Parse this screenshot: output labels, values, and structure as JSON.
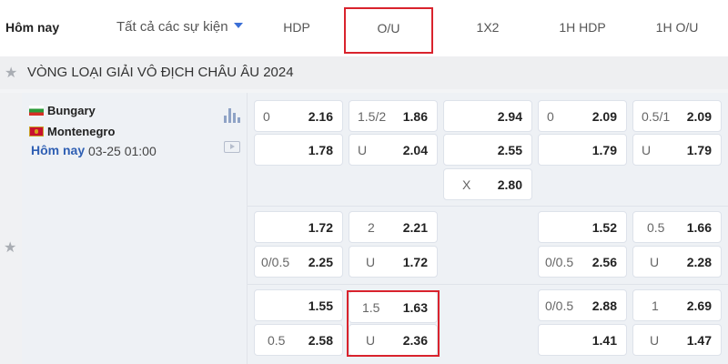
{
  "tabs": {
    "today": "Hôm nay",
    "all_events": "Tất cả các sự kiện",
    "markets": [
      "HDP",
      "O/U",
      "1X2",
      "1H HDP",
      "1H O/U"
    ],
    "selected_market": "O/U"
  },
  "league": {
    "name": "VÒNG LOẠI GIẢI VÔ ĐỊCH CHÂU ÂU 2024"
  },
  "match": {
    "home": "Bungary",
    "away": "Montenegro",
    "day": "Hôm nay",
    "kickoff": "03-25 01:00"
  },
  "odds": {
    "r1": {
      "hdp_home": {
        "line": "0",
        "price": "2.16"
      },
      "ou_over": {
        "line": "1.5/2",
        "price": "1.86"
      },
      "x12_home": {
        "line": "",
        "price": "2.94"
      },
      "h1hdp_home": {
        "line": "0",
        "price": "2.09"
      },
      "h1ou_over": {
        "line": "0.5/1",
        "price": "2.09"
      }
    },
    "r2": {
      "hdp_away": {
        "line": "",
        "price": "1.78"
      },
      "ou_under": {
        "line": "U",
        "price": "2.04"
      },
      "x12_away": {
        "line": "",
        "price": "2.55"
      },
      "h1hdp_away": {
        "line": "",
        "price": "1.79"
      },
      "h1ou_under": {
        "line": "U",
        "price": "1.79"
      }
    },
    "r3": {
      "x12_draw": {
        "line": "X",
        "price": "2.80"
      }
    },
    "r4": {
      "hdp_home": {
        "line": "",
        "price": "1.72"
      },
      "ou_over": {
        "line": "2",
        "price": "2.21"
      },
      "h1hdp_home": {
        "line": "",
        "price": "1.52"
      },
      "h1ou_over": {
        "line": "0.5",
        "price": "1.66"
      }
    },
    "r5": {
      "hdp_away": {
        "line": "0/0.5",
        "price": "2.25"
      },
      "ou_under": {
        "line": "U",
        "price": "1.72"
      },
      "h1hdp_away": {
        "line": "0/0.5",
        "price": "2.56"
      },
      "h1ou_under": {
        "line": "U",
        "price": "2.28"
      }
    },
    "r6": {
      "hdp_home": {
        "line": "",
        "price": "1.55"
      },
      "ou_over": {
        "line": "1.5",
        "price": "1.63"
      },
      "h1hdp_home": {
        "line": "0/0.5",
        "price": "2.88"
      },
      "h1ou_over": {
        "line": "1",
        "price": "2.69"
      }
    },
    "r7": {
      "hdp_away": {
        "line": "0.5",
        "price": "2.58"
      },
      "ou_under": {
        "line": "U",
        "price": "2.36"
      },
      "h1hdp_away": {
        "line": "",
        "price": "1.41"
      },
      "h1ou_under": {
        "line": "U",
        "price": "1.47"
      }
    }
  },
  "colors": {
    "highlight": "#d9232d",
    "accent": "#2f5fb3",
    "background": "#eef1f5"
  },
  "icons": [
    "star-icon",
    "stats-icon",
    "video-icon",
    "caret-down-icon"
  ]
}
